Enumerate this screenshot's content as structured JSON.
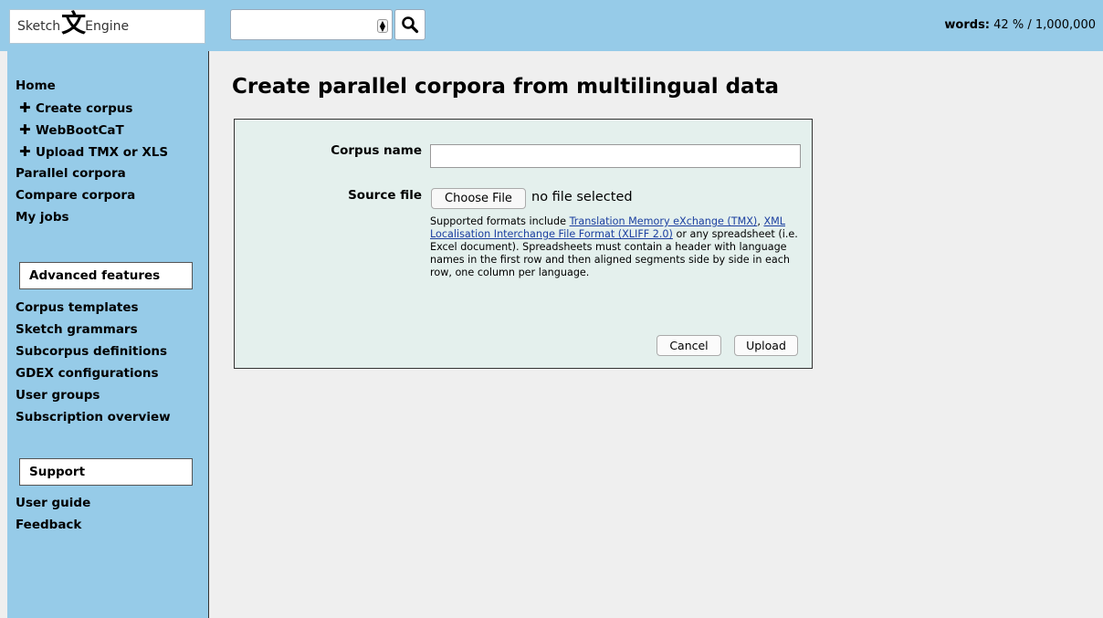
{
  "header": {
    "logo_left": "Sketch",
    "logo_glyph": "文",
    "logo_right": "Engine",
    "search_value": "",
    "words_label": "words:",
    "words_value": "42 % / 1,000,000"
  },
  "sidebar": {
    "home": "Home",
    "create_items": [
      {
        "label": "Create corpus"
      },
      {
        "label": "WebBootCaT"
      },
      {
        "label": "Upload TMX or XLS"
      }
    ],
    "parallel": "Parallel corpora",
    "compare": "Compare corpora",
    "jobs": "My jobs",
    "advanced_title": "Advanced features",
    "advanced_items": [
      {
        "label": "Corpus templates"
      },
      {
        "label": "Sketch grammars"
      },
      {
        "label": "Subcorpus definitions"
      },
      {
        "label": "GDEX configurations"
      },
      {
        "label": "User groups"
      },
      {
        "label": "Subscription overview"
      }
    ],
    "support_title": "Support",
    "support_items": [
      {
        "label": "User guide"
      },
      {
        "label": "Feedback"
      }
    ]
  },
  "main": {
    "title": "Create parallel corpora from multilingual data",
    "corpus_name_label": "Corpus name",
    "corpus_name_value": "",
    "source_file_label": "Source file",
    "choose_file": "Choose File",
    "file_status": "no file selected",
    "help_intro": "Supported formats include ",
    "help_link1": "Translation Memory eXchange (TMX)",
    "help_sep": ", ",
    "help_link2": "XML Localisation Interchange File Format (XLIFF 2.0)",
    "help_rest": " or any spreadsheet (i.e. Excel document). Spreadsheets must contain a header with language names in the first row and then aligned segments side by side in each row, one column per language.",
    "cancel": "Cancel",
    "upload": "Upload"
  }
}
